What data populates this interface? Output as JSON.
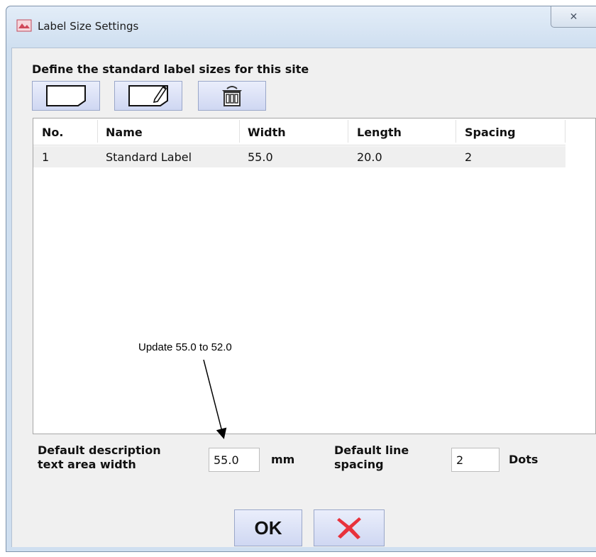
{
  "window": {
    "title": "Label Size Settings",
    "close_glyph": "✕"
  },
  "heading": "Define the standard label sizes for this site",
  "toolbar": [
    {
      "name": "new-label-button",
      "icon": "new-document-icon"
    },
    {
      "name": "edit-label-button",
      "icon": "edit-document-icon"
    },
    {
      "name": "delete-label-button",
      "icon": "trash-can-icon"
    }
  ],
  "table": {
    "columns": [
      "No.",
      "Name",
      "Width",
      "Length",
      "Spacing"
    ],
    "rows": [
      {
        "no": "1",
        "name": "Standard Label",
        "width": "55.0",
        "length": "20.0",
        "spacing": "2"
      }
    ]
  },
  "annotation": "Update 55.0 to 52.0",
  "fields": {
    "desc_width_label": "Default description\ntext area width",
    "desc_width_value": "55.0",
    "desc_width_unit": "mm",
    "line_spacing_label": "Default line\nspacing",
    "line_spacing_value": "2",
    "line_spacing_unit": "Dots"
  },
  "buttons": {
    "ok_label": "OK",
    "cancel_icon": "red-x-icon"
  },
  "colors": {
    "cancel_red": "#e8323c",
    "button_bg": "#d8def5"
  }
}
